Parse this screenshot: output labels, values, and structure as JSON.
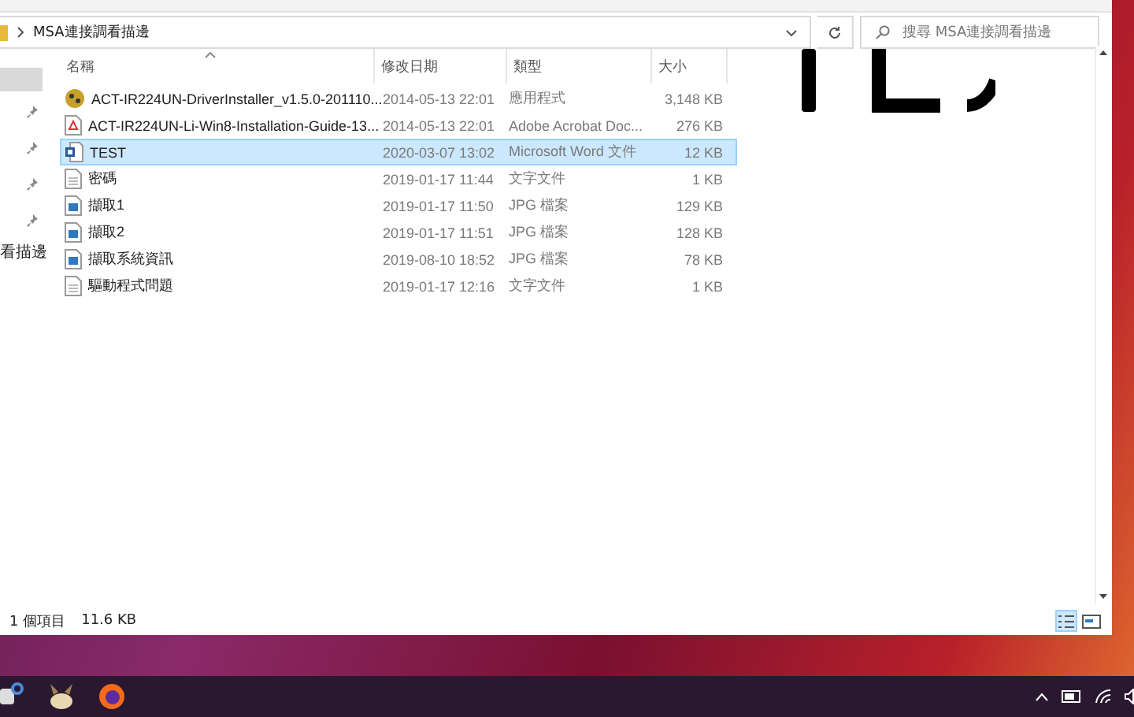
{
  "address_bar": {
    "path": "MSA連接調看描邊"
  },
  "search": {
    "placeholder": "搜尋 MSA連接調看描邊"
  },
  "sidebar": {
    "items": [
      {
        "label": "看描邊"
      }
    ]
  },
  "table": {
    "columns": [
      "名稱",
      "修改日期",
      "類型",
      "大小"
    ],
    "rows": [
      {
        "kind": "installer",
        "name": "ACT-IR224UN-DriverInstaller_v1.5.0-201110...",
        "date": "2014-05-13 22:01",
        "type": "應用程式",
        "size": "3,148 KB",
        "selected": false
      },
      {
        "kind": "pdf",
        "name": "ACT-IR224UN-Li-Win8-Installation-Guide-13...",
        "date": "2014-05-13 22:01",
        "type": "Adobe Acrobat Doc...",
        "size": "276 KB",
        "selected": false
      },
      {
        "kind": "word",
        "name": "TEST",
        "date": "2020-03-07 13:02",
        "type": "Microsoft Word 文件",
        "size": "12 KB",
        "selected": true
      },
      {
        "kind": "text",
        "name": "密碼",
        "date": "2019-01-17 11:44",
        "type": "文字文件",
        "size": "1 KB",
        "selected": false
      },
      {
        "kind": "image",
        "name": "擷取1",
        "date": "2019-01-17 11:50",
        "type": "JPG 檔案",
        "size": "129 KB",
        "selected": false
      },
      {
        "kind": "image",
        "name": "擷取2",
        "date": "2019-01-17 11:51",
        "type": "JPG 檔案",
        "size": "128 KB",
        "selected": false
      },
      {
        "kind": "image",
        "name": "擷取系統資訊",
        "date": "2019-08-10 18:52",
        "type": "JPG 檔案",
        "size": "78 KB",
        "selected": false
      },
      {
        "kind": "text",
        "name": "驅動程式問題",
        "date": "2019-01-17 12:16",
        "type": "文字文件",
        "size": "1 KB",
        "selected": false
      }
    ]
  },
  "status_bar": {
    "item_count": "1 個項目",
    "size": "11.6 KB"
  },
  "view_buttons": [
    {
      "kind": "details",
      "selected": true
    },
    {
      "kind": "preview",
      "selected": false
    }
  ]
}
